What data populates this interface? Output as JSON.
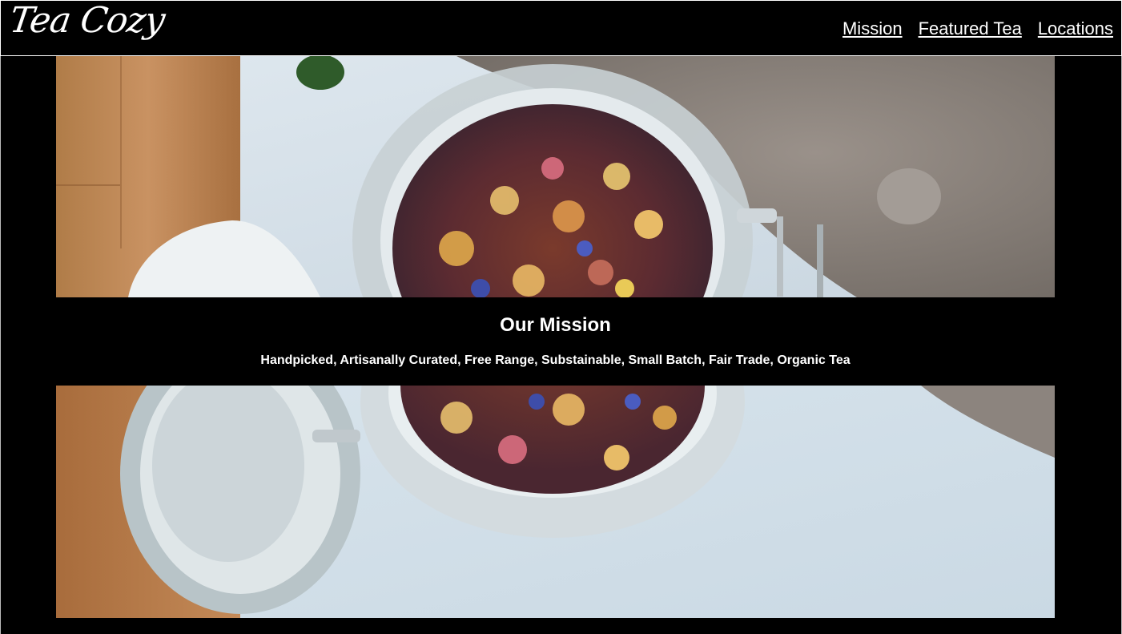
{
  "header": {
    "logo_text": "Tea Cozy",
    "nav": [
      {
        "label": "Mission"
      },
      {
        "label": "Featured Tea"
      },
      {
        "label": "Locations"
      }
    ]
  },
  "mission": {
    "title": "Our Mission",
    "text": "Handpicked, Artisanally Curated, Free Range, Substainable, Small Batch, Fair Trade, Organic Tea"
  },
  "hero": {
    "image_subject": "open glass jar of loose-leaf fruit tea on white table next to wooden board and knit cloth"
  },
  "colors": {
    "background": "#000000",
    "text": "#ffffff",
    "header_border": "#ffffff"
  }
}
